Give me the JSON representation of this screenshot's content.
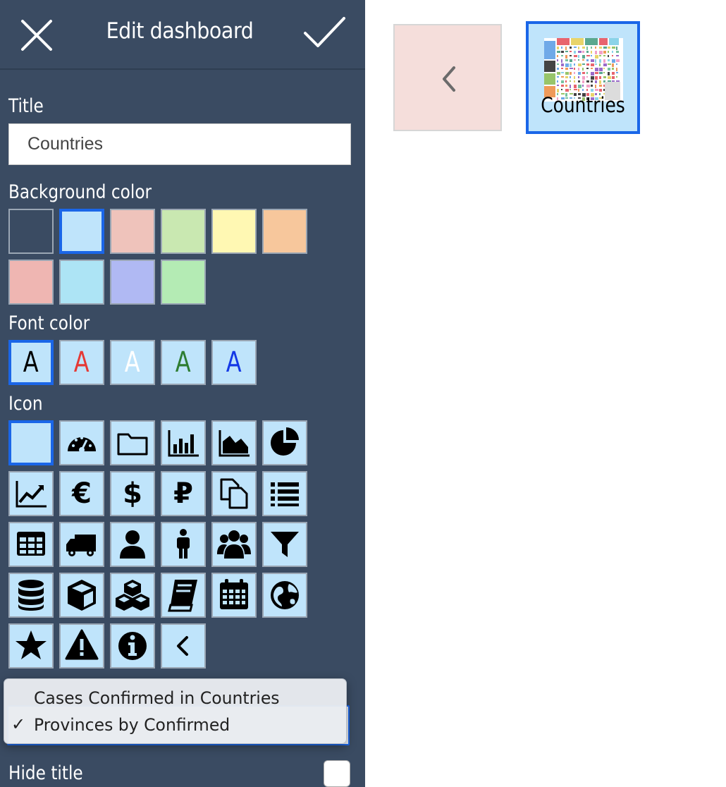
{
  "header": {
    "title": "Edit dashboard"
  },
  "title_section": {
    "label": "Title",
    "value": "Countries"
  },
  "background_section": {
    "label": "Background color",
    "colors": [
      "#3a4b62",
      "#bfe4fb",
      "#efc3bb",
      "#c9e8b1",
      "#fff8b3",
      "#f7c79c",
      "#efb6b2",
      "#ade4f5",
      "#b0b9f3",
      "#b4ebb4"
    ],
    "selected_index": 1
  },
  "font_section": {
    "label": "Font color",
    "glyph": "A",
    "colors": [
      "#000000",
      "#e53935",
      "#ffffff",
      "#2e7d32",
      "#1438e6"
    ],
    "selected_index": 0
  },
  "icon_section": {
    "label": "Icon",
    "icons": [
      "none-icon",
      "gauge-icon",
      "folder-icon",
      "bar-chart-icon",
      "area-chart-icon",
      "pie-chart-icon",
      "line-chart-icon",
      "euro-icon",
      "dollar-icon",
      "ruble-icon",
      "copy-icon",
      "list-icon",
      "table-icon",
      "truck-icon",
      "user-icon",
      "male-icon",
      "users-icon",
      "filter-icon",
      "database-icon",
      "cube-icon",
      "cubes-icon",
      "book-icon",
      "calendar-icon",
      "globe-icon",
      "star-icon",
      "warning-icon",
      "info-icon",
      "chevron-left-icon"
    ],
    "glyphs": {
      "euro-icon": "€",
      "dollar-icon": "$",
      "ruble-icon": "₽"
    },
    "selected_index": 0
  },
  "dropdown": {
    "options": [
      {
        "label": "Cases Confirmed in Countries",
        "checked": false
      },
      {
        "label": "Provinces by Confirmed",
        "checked": true
      }
    ],
    "check_mark": "✓"
  },
  "hide_title": {
    "label": "Hide title"
  },
  "tiles": {
    "back_tile_color": "#f5dedb",
    "countries_label": "Countries",
    "accent": "#1a66e8"
  }
}
